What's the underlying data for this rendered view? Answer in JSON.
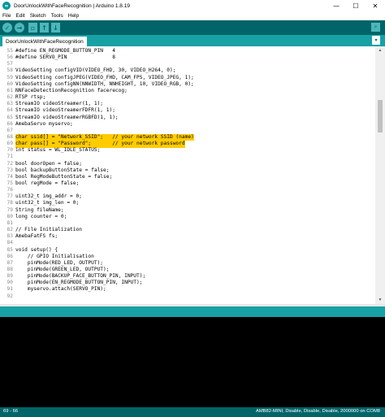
{
  "window": {
    "title": "DoorUnlockWithFaceRecognition | Arduino 1.8.19",
    "icon": "arduino-icon"
  },
  "menu": [
    "File",
    "Edit",
    "Sketch",
    "Tools",
    "Help"
  ],
  "toolbar": {
    "verify": "verify-icon",
    "upload": "upload-icon",
    "new": "new-file-icon",
    "open": "open-icon",
    "save": "save-icon",
    "serial_monitor": "serial-monitor-icon"
  },
  "tab": {
    "label": "DoorUnlockWithFaceRecognition"
  },
  "editor": {
    "lines": [
      {
        "n": "55",
        "code": "#define EN_REGMODE_BUTTON_PIN   4"
      },
      {
        "n": "56",
        "code": "#define SERVO_PIN               8"
      },
      {
        "n": "57",
        "code": ""
      },
      {
        "n": "58",
        "code": "VideoSetting configVID(VIDEO_FHD, 30, VIDEO_H264, 0);"
      },
      {
        "n": "59",
        "code": "VideoSetting configJPEG(VIDEO_FHD, CAM_FPS, VIDEO_JPEG, 1);"
      },
      {
        "n": "60",
        "code": "VideoSetting configNN(NNWIDTH, NNHEIGHT, 10, VIDEO_RGB, 0);"
      },
      {
        "n": "61",
        "code": "NNFaceDetectionRecognition facerecog;"
      },
      {
        "n": "62",
        "code": "RTSP rtsp;"
      },
      {
        "n": "63",
        "code": "StreamIO videoStreamer(1, 1);"
      },
      {
        "n": "64",
        "code": "StreamIO videoStreamerFDFR(1, 1);"
      },
      {
        "n": "65",
        "code": "StreamIO videoStreamerRGBFD(1, 1);"
      },
      {
        "n": "66",
        "code": "AmebaServo myservo;"
      },
      {
        "n": "67",
        "code": ""
      },
      {
        "n": "68",
        "code": "char ssid[] = \"Network_SSID\";   // your network SSID (name)",
        "hl": true
      },
      {
        "n": "69",
        "code": "char pass[] = \"Password\";       // your network password",
        "hl": true
      },
      {
        "n": "70",
        "code": "int status = WL_IDLE_STATUS;"
      },
      {
        "n": "71",
        "code": ""
      },
      {
        "n": "72",
        "code": "bool doorOpen = false;"
      },
      {
        "n": "73",
        "code": "bool backupButtonState = false;"
      },
      {
        "n": "74",
        "code": "bool RegModeButtonState = false;"
      },
      {
        "n": "75",
        "code": "bool regMode = false;"
      },
      {
        "n": "76",
        "code": ""
      },
      {
        "n": "77",
        "code": "uint32_t img_addr = 0;"
      },
      {
        "n": "78",
        "code": "uint32_t img_len = 0;"
      },
      {
        "n": "79",
        "code": "String fileName;"
      },
      {
        "n": "80",
        "code": "long counter = 0;"
      },
      {
        "n": "81",
        "code": ""
      },
      {
        "n": "82",
        "code": "// File Initialization"
      },
      {
        "n": "83",
        "code": "AmebaFatFS fs;"
      },
      {
        "n": "84",
        "code": ""
      },
      {
        "n": "85",
        "code": "void setup() {"
      },
      {
        "n": "86",
        "code": "    // GPIO Initialisation"
      },
      {
        "n": "87",
        "code": "    pinMode(RED_LED, OUTPUT);"
      },
      {
        "n": "88",
        "code": "    pinMode(GREEN_LED, OUTPUT);"
      },
      {
        "n": "89",
        "code": "    pinMode(BACKUP_FACE_BUTTON_PIN, INPUT);"
      },
      {
        "n": "90",
        "code": "    pinMode(EN_REGMODE_BUTTON_PIN, INPUT);"
      },
      {
        "n": "91",
        "code": "    myservo.attach(SERVO_PIN);"
      },
      {
        "n": "92",
        "code": ""
      }
    ]
  },
  "status": {
    "line_info": "69 - 66",
    "board_info": "AMB82-MINI, Disable, Disable, Disable, 2000000 on COM8"
  },
  "colors": {
    "toolbar": "#006468",
    "tabbar": "#17a1a5",
    "highlight": "#ffcc00",
    "console": "#000000"
  }
}
